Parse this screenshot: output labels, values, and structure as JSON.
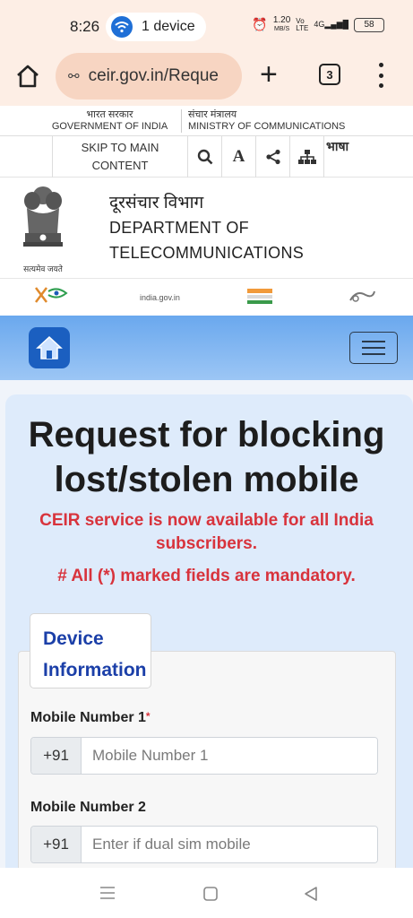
{
  "status_bar": {
    "time": "8:26",
    "connection_pill": "1 device",
    "speed": "1.20",
    "speed_unit": "MB/S",
    "network": "4G",
    "battery": "58"
  },
  "browser": {
    "url": "ceir.gov.in/Reque",
    "tab_count": "3"
  },
  "gov_strip": {
    "left_hindi": "भारत सरकार",
    "left_english": "GOVERNMENT OF INDIA",
    "right_hindi": "संचार मंत्रालय",
    "right_english": "MINISTRY OF COMMUNICATIONS"
  },
  "toolbar": {
    "skip_line1": "SKIP TO MAIN",
    "skip_line2": "CONTENT",
    "font_label": "A",
    "language_label": "भाषा"
  },
  "department": {
    "emblem_caption": "सत्यमेव जयते",
    "name_hindi": "दूरसंचार विभाग",
    "name_line1": "DEPARTMENT OF",
    "name_line2": "TELECOMMUNICATIONS"
  },
  "logos": {
    "india_gov": "india.gov.in"
  },
  "page": {
    "title_line1": "Request for blocking",
    "title_line2": "lost/stolen mobile",
    "notice_line1": "CEIR service is now available for all India",
    "notice_line2": "subscribers.",
    "mandatory": "# All (*) marked fields are mandatory."
  },
  "form": {
    "tab_line1": "Device",
    "tab_line2": "Information",
    "mobile1_label": "Mobile Number 1",
    "mobile1_required": "*",
    "mobile1_prefix": "+91",
    "mobile1_placeholder": "Mobile Number 1",
    "mobile2_label": "Mobile Number 2",
    "mobile2_prefix": "+91",
    "mobile2_placeholder": "Enter if dual sim mobile"
  },
  "colors": {
    "accent_blue": "#1b5fc0",
    "alert_red": "#d8333c",
    "tab_text": "#1b3fa8",
    "browser_bg": "#fdeee5"
  }
}
